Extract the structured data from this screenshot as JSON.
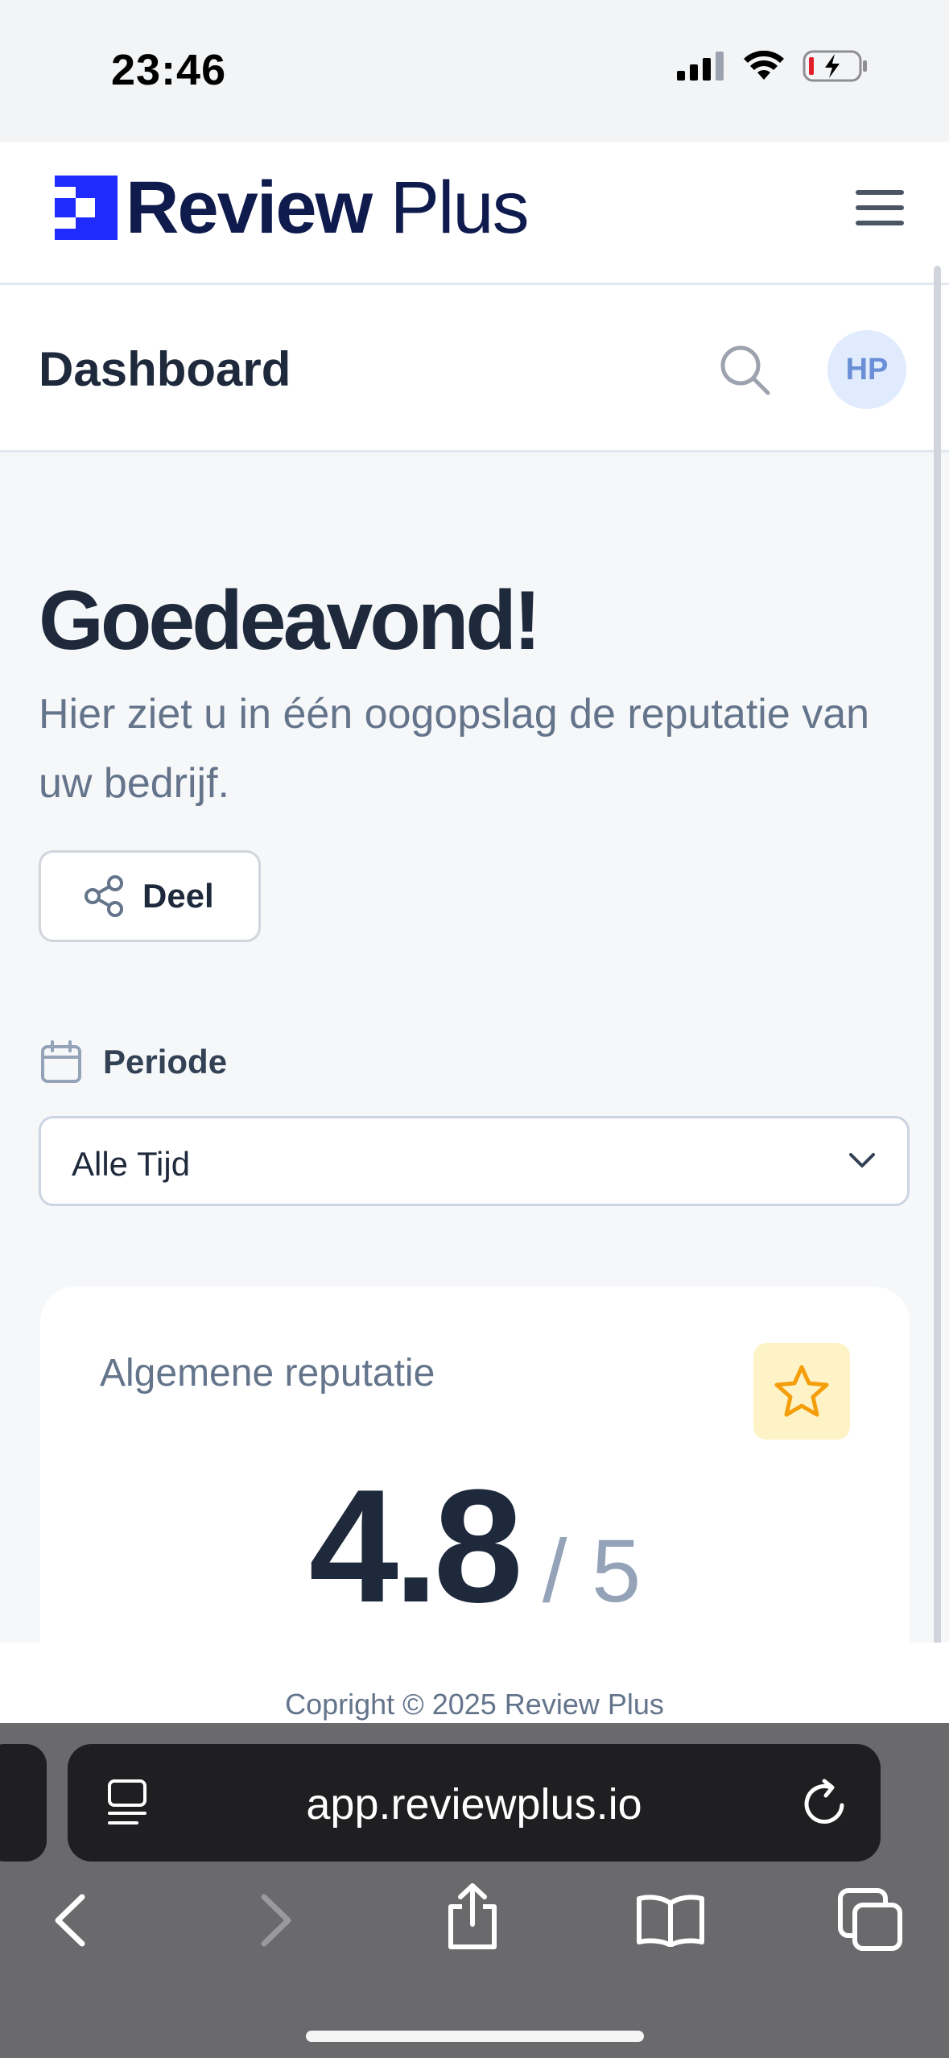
{
  "status": {
    "time": "23:46"
  },
  "header": {
    "logo_bold": "Review",
    "logo_light": " Plus"
  },
  "subheader": {
    "title": "Dashboard",
    "avatar_initials": "HP"
  },
  "main": {
    "greeting": "Goedeavond!",
    "subtitle": "Hier ziet u in één oogopslag de reputatie van uw bedrijf.",
    "share_label": "Deel",
    "period_label": "Periode",
    "period_value": "Alle Tijd",
    "card": {
      "title": "Algemene reputatie",
      "score": "4.8",
      "denominator": "/ 5"
    }
  },
  "footer": {
    "copyright": "Copright © 2025 Review Plus"
  },
  "browser": {
    "url": "app.reviewplus.io"
  },
  "colors": {
    "brand_blue": "#1f2bff",
    "navy": "#0f1a4d",
    "star": "#f59e0b",
    "star_bg": "#fef3c7"
  }
}
